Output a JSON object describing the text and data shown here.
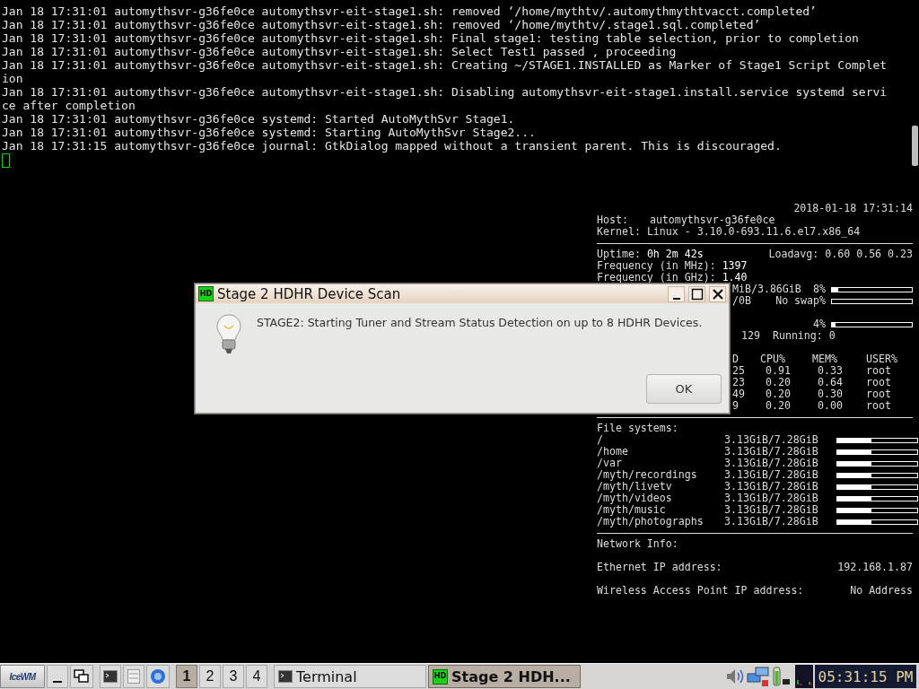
{
  "terminal": {
    "lines": [
      "Jan 18 17:31:01 automythsvr-g36fe0ce automythsvr-eit-stage1.sh: removed ‘/home/mythtv/.automythmythtvacct.completed’",
      "Jan 18 17:31:01 automythsvr-g36fe0ce automythsvr-eit-stage1.sh: removed ‘/home/mythtv/.stage1.sql.completed’",
      "Jan 18 17:31:01 automythsvr-g36fe0ce automythsvr-eit-stage1.sh: Final stage1: testing table selection, prior to completion",
      "Jan 18 17:31:01 automythsvr-g36fe0ce automythsvr-eit-stage1.sh: Select Test1 passed , proceeding",
      "Jan 18 17:31:01 automythsvr-g36fe0ce automythsvr-eit-stage1.sh: Creating ~/STAGE1.INSTALLED as Marker of Stage1 Script Complet",
      "ion",
      "Jan 18 17:31:01 automythsvr-g36fe0ce automythsvr-eit-stage1.sh: Disabling automythsvr-eit-stage1.install.service systemd servi",
      "ce after completion",
      "Jan 18 17:31:01 automythsvr-g36fe0ce systemd: Started AutoMythSvr Stage1.",
      "Jan 18 17:31:01 automythsvr-g36fe0ce systemd: Starting AutoMythSvr Stage2...",
      "Jan 18 17:31:15 automythsvr-g36fe0ce journal: GtkDialog mapped without a transient parent. This is discouraged."
    ]
  },
  "conky": {
    "datetime": "2018-01-18 17:31:14",
    "host": {
      "label": "Host:",
      "value": "automythsvr-g36fe0ce"
    },
    "kernel": {
      "label": "Kernel:",
      "value": "Linux - 3.10.0-693.11.6.el7.x86_64"
    },
    "uptime": {
      "label": "Uptime:",
      "value": "0h 2m 42s"
    },
    "loadavg": {
      "label": "Loadavg:",
      "value": "0.60 0.56 0.23"
    },
    "freq_mhz": {
      "label": "Frequency (in MHz):",
      "value": "1397"
    },
    "freq_ghz": {
      "label": "Frequency (in GHz):",
      "value": "1.40"
    },
    "memory": {
      "text": "MiB/3.86GiB",
      "percent": "8%",
      "level": 0.08
    },
    "swap": {
      "text": "/0B",
      "percent": "No swap%",
      "level": 0
    },
    "cpu": {
      "percent": "4%",
      "level": 0.04
    },
    "processes": {
      "count": "129",
      "running": "Running: 0"
    },
    "top": {
      "header": [
        "D",
        "CPU%",
        "MEM%",
        "USER%"
      ],
      "rows": [
        [
          "25",
          "0.91",
          "0.33",
          "root"
        ],
        [
          "23",
          "0.20",
          "0.64",
          "root"
        ],
        [
          "49",
          "0.20",
          "0.30",
          "root"
        ],
        [
          "9",
          "0.20",
          "0.00",
          "root"
        ]
      ]
    },
    "file_systems": {
      "title": "File systems:",
      "items": [
        {
          "mount": "/",
          "usage": "3.13GiB/7.28GiB",
          "level": 0.43
        },
        {
          "mount": "/home",
          "usage": "3.13GiB/7.28GiB",
          "level": 0.43
        },
        {
          "mount": "/var",
          "usage": "3.13GiB/7.28GiB",
          "level": 0.43
        },
        {
          "mount": "/myth/recordings",
          "usage": "3.13GiB/7.28GiB",
          "level": 0.43
        },
        {
          "mount": "/myth/livetv",
          "usage": "3.13GiB/7.28GiB",
          "level": 0.43
        },
        {
          "mount": "/myth/videos",
          "usage": "3.13GiB/7.28GiB",
          "level": 0.43
        },
        {
          "mount": "/myth/music",
          "usage": "3.13GiB/7.28GiB",
          "level": 0.43
        },
        {
          "mount": "/myth/photographs",
          "usage": "3.13GiB/7.28GiB",
          "level": 0.43
        }
      ]
    },
    "network": {
      "title": "Network Info:",
      "ethernet": {
        "label": "Ethernet IP address:",
        "value": "192.168.1.87"
      },
      "wireless": {
        "label": "Wireless Access Point IP address:",
        "value": "No Address"
      }
    }
  },
  "dialog": {
    "title": "Stage 2 HDHR Device Scan",
    "app_icon": "HD",
    "message": "STAGE2: Starting Tuner and Stream Status Detection on up to 8 HDHR Devices.",
    "button": "OK"
  },
  "taskbar": {
    "logo": "IceWM",
    "workspaces": [
      {
        "label": "1",
        "selected": true
      },
      {
        "label": "2",
        "selected": false
      },
      {
        "label": "3",
        "selected": false
      },
      {
        "label": "4",
        "selected": false
      }
    ],
    "tasks": [
      {
        "kind": "terminal",
        "label": "Terminal",
        "selected": false
      },
      {
        "kind": "app",
        "label": "Stage 2 HDH...",
        "icon": "HD",
        "selected": true
      }
    ],
    "clock": "05:31:15 PM"
  }
}
